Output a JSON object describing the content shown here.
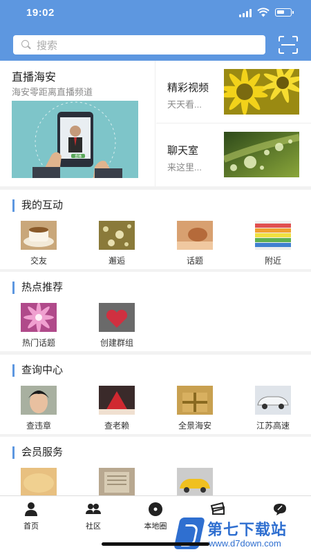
{
  "status_bar": {
    "time": "19:02"
  },
  "search": {
    "placeholder": "搜索"
  },
  "banner": {
    "live": {
      "title": "直播海安",
      "subtitle": "海安零距离直播频道",
      "image_badge": "直播"
    },
    "cards": [
      {
        "title": "精彩视频",
        "subtitle": "天天看..."
      },
      {
        "title": "聊天室",
        "subtitle": "来这里..."
      }
    ]
  },
  "sections": [
    {
      "title": "我的互动",
      "items": [
        "交友",
        "邂逅",
        "话题",
        "附近"
      ]
    },
    {
      "title": "热点推荐",
      "items": [
        "热门话题",
        "创建群组"
      ]
    },
    {
      "title": "查询中心",
      "items": [
        "查违章",
        "查老赖",
        "全景海安",
        "江苏高速"
      ]
    },
    {
      "title": "会员服务",
      "items": []
    }
  ],
  "tabbar": {
    "items": [
      "首页",
      "社区",
      "本地圈",
      "",
      ""
    ]
  },
  "watermark": {
    "name": "第七下载站",
    "url": "www.d7down.com"
  },
  "colors": {
    "accent": "#5d97e0"
  }
}
